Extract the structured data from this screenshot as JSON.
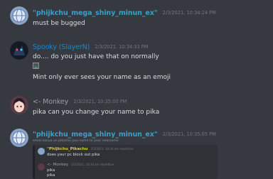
{
  "messages": [
    {
      "author": "\"phijkchu_mega_shiny_minun_ex\"",
      "author_color": "#3ba0c8",
      "timestamp": "2/3/2021, 10:34:24 PM",
      "lines": [
        "must be bugged"
      ],
      "avatar": "globe-avatar-icon"
    },
    {
      "author": "Spooky (SlayerN)",
      "author_color": "#1e88c8",
      "timestamp": "2/3/2021, 10:34:33 PM",
      "lines": [
        "do.... do you just have that on normally",
        "Mint only ever sees your name as an emoji"
      ],
      "avatar": "dark-character-avatar-icon"
    },
    {
      "author": "<- Monkey",
      "author_color": "#9aa0a6",
      "timestamp": "2/3/2021, 10:35:00 PM",
      "lines": [
        "pika can you change your name to pika"
      ],
      "avatar": "anime-girl-avatar-icon"
    },
    {
      "author": "\"phijkchu_mega_shiny_minun_ex\"",
      "author_color": "#3ba0c8",
      "timestamp": "2/3/2021, 10:35:05 PM",
      "avatar": "globe-avatar-icon"
    }
  ],
  "embed": {
    "header": "emas kosua un pikachu you name to your nearsome",
    "reply1": {
      "author": "\"Phijkchu_Pikachu",
      "author_color": "#d9c84a",
      "timestamp": "2/3/2021, 10:34 am repetitive",
      "text": "does your pc block out pika"
    },
    "reply2": {
      "author": "<- Monkey",
      "author_color": "#9aa0a6",
      "timestamp": "2/3/2021, 10:34 am repetitive",
      "lines": [
        "pika",
        "pika"
      ]
    }
  }
}
